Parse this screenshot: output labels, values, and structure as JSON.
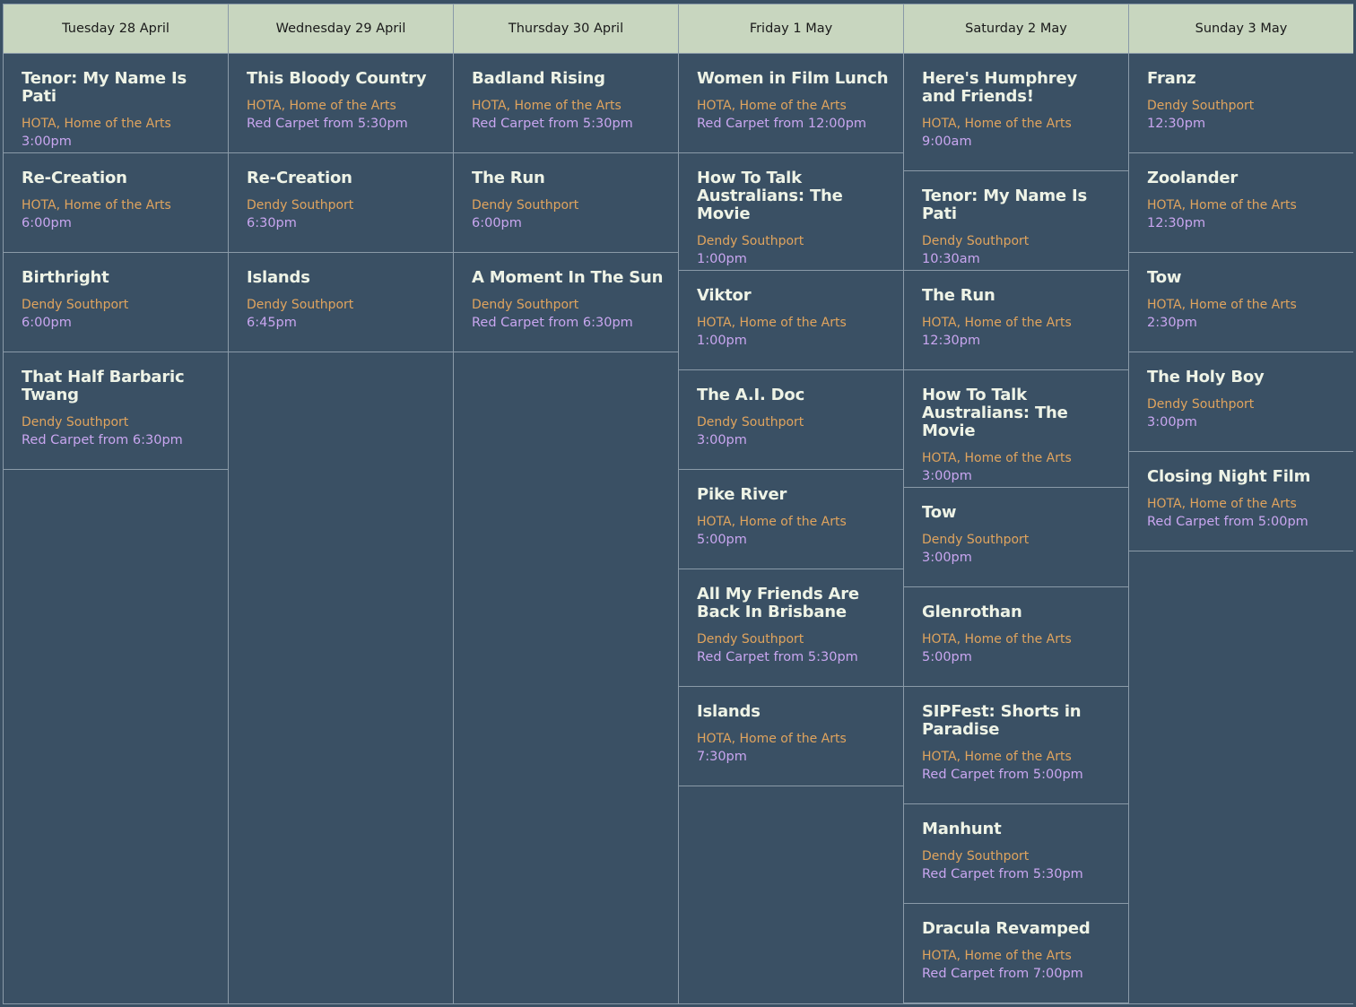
{
  "days": [
    {
      "label": "Tuesday 28 April",
      "events": [
        {
          "title": "Tenor: My Name Is Pati",
          "venue": "HOTA, Home of the Arts",
          "time": "3:00pm"
        },
        {
          "title": "Re-Creation",
          "venue": "HOTA, Home of the Arts",
          "time": "6:00pm"
        },
        {
          "title": "Birthright",
          "venue": "Dendy Southport",
          "time": "6:00pm"
        },
        {
          "title": "That Half Barbaric Twang",
          "venue": "Dendy Southport",
          "time": "Red Carpet from 6:30pm"
        }
      ]
    },
    {
      "label": "Wednesday 29 April",
      "events": [
        {
          "title": "This Bloody Country",
          "venue": "HOTA, Home of the Arts",
          "time": "Red Carpet from 5:30pm"
        },
        {
          "title": "Re-Creation",
          "venue": "Dendy Southport",
          "time": "6:30pm"
        },
        {
          "title": "Islands",
          "venue": "Dendy Southport",
          "time": "6:45pm"
        }
      ]
    },
    {
      "label": "Thursday 30 April",
      "events": [
        {
          "title": "Badland Rising",
          "venue": "HOTA, Home of the Arts",
          "time": "Red Carpet from 5:30pm"
        },
        {
          "title": "The Run",
          "venue": "Dendy Southport",
          "time": "6:00pm"
        },
        {
          "title": "A Moment In The Sun",
          "venue": "Dendy Southport",
          "time": "Red Carpet from 6:30pm"
        }
      ]
    },
    {
      "label": "Friday 1 May",
      "events": [
        {
          "title": "Women in Film Lunch",
          "venue": "HOTA, Home of the Arts",
          "time": "Red Carpet from 12:00pm"
        },
        {
          "title": "How To Talk Australians: The Movie",
          "venue": "Dendy Southport",
          "time": "1:00pm"
        },
        {
          "title": "Viktor",
          "venue": "HOTA, Home of the Arts",
          "time": "1:00pm"
        },
        {
          "title": "The A.I. Doc",
          "venue": "Dendy Southport",
          "time": "3:00pm"
        },
        {
          "title": "Pike River",
          "venue": "HOTA, Home of the Arts",
          "time": "5:00pm"
        },
        {
          "title": "All My Friends Are Back In Brisbane",
          "venue": "Dendy Southport",
          "time": "Red Carpet from 5:30pm"
        },
        {
          "title": "Islands",
          "venue": "HOTA, Home of the Arts",
          "time": "7:30pm"
        }
      ]
    },
    {
      "label": "Saturday 2 May",
      "events": [
        {
          "title": "Here's Humphrey and Friends!",
          "venue": "HOTA, Home of the Arts",
          "time": "9:00am"
        },
        {
          "title": "Tenor: My Name Is Pati",
          "venue": "Dendy Southport",
          "time": "10:30am"
        },
        {
          "title": "The Run",
          "venue": "HOTA, Home of the Arts",
          "time": "12:30pm"
        },
        {
          "title": "How To Talk Australians: The Movie",
          "venue": "HOTA, Home of the Arts",
          "time": "3:00pm"
        },
        {
          "title": "Tow",
          "venue": "Dendy Southport",
          "time": "3:00pm"
        },
        {
          "title": "Glenrothan",
          "venue": "HOTA, Home of the Arts",
          "time": "5:00pm"
        },
        {
          "title": "SIPFest: Shorts in Paradise",
          "venue": "HOTA, Home of the Arts",
          "time": "Red Carpet from 5:00pm"
        },
        {
          "title": "Manhunt",
          "venue": "Dendy Southport",
          "time": "Red Carpet from 5:30pm"
        },
        {
          "title": "Dracula Revamped",
          "venue": "HOTA, Home of the Arts",
          "time": "Red Carpet from 7:00pm"
        }
      ]
    },
    {
      "label": "Sunday 3 May",
      "events": [
        {
          "title": "Franz",
          "venue": "Dendy Southport",
          "time": "12:30pm"
        },
        {
          "title": "Zoolander",
          "venue": "HOTA, Home of the Arts",
          "time": "12:30pm"
        },
        {
          "title": "Tow",
          "venue": "HOTA, Home of the Arts",
          "time": "2:30pm"
        },
        {
          "title": "The Holy Boy",
          "venue": "Dendy Southport",
          "time": "3:00pm"
        },
        {
          "title": "Closing Night Film",
          "venue": "HOTA, Home of the Arts",
          "time": "Red Carpet from 5:00pm"
        }
      ]
    }
  ]
}
